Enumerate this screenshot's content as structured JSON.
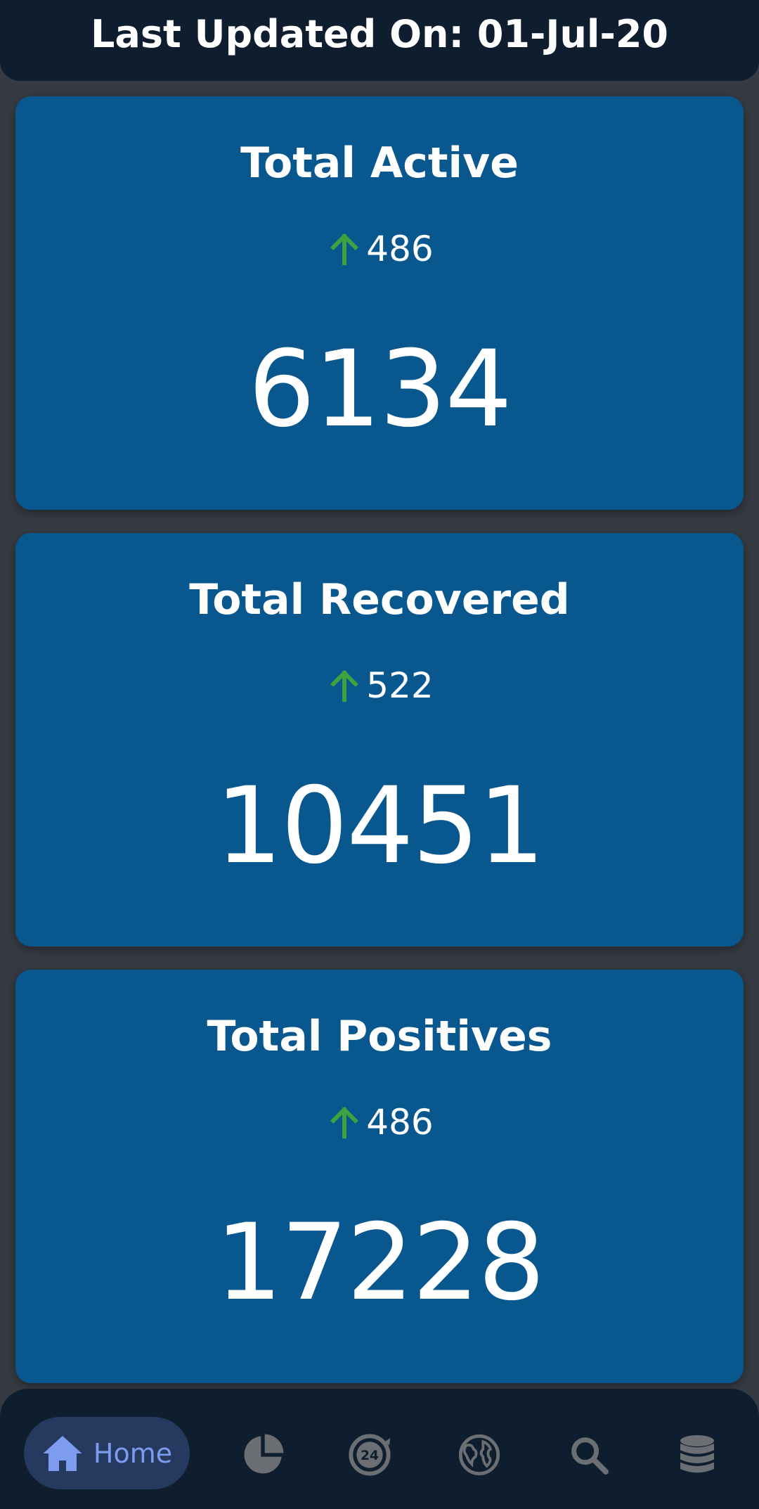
{
  "header": {
    "title": "Last Updated On: 01-Jul-20"
  },
  "cards": [
    {
      "title": "Total Active",
      "delta": "486",
      "value": "6134"
    },
    {
      "title": "Total Recovered",
      "delta": "522",
      "value": "10451"
    },
    {
      "title": "Total Positives",
      "delta": "486",
      "value": "17228"
    }
  ],
  "bottom_nav": {
    "home_label": "Home",
    "items": [
      {
        "icon": "home-icon",
        "label": "Home",
        "selected": true
      },
      {
        "icon": "pie-chart-icon"
      },
      {
        "icon": "24-hours-icon"
      },
      {
        "icon": "globe-icon"
      },
      {
        "icon": "search-icon"
      },
      {
        "icon": "database-icon"
      }
    ]
  },
  "colors": {
    "background": "#363a42",
    "header_bg": "#0e1e2e",
    "card_bg": "#08578f",
    "delta_arrow": "#3ea33e",
    "nav_selected_bg": "#253a5e",
    "nav_selected_fg": "#7d9cf0",
    "nav_icon": "#6b6e73"
  }
}
